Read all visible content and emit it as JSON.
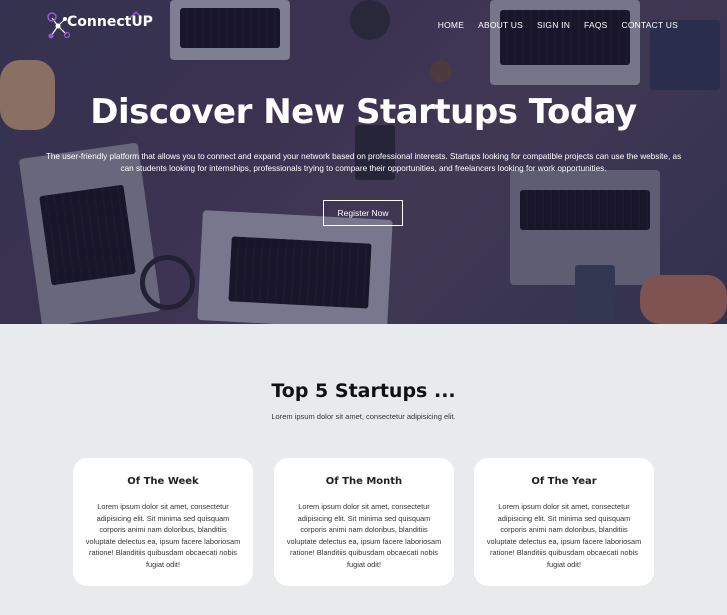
{
  "nav": {
    "brand": "ConnectUP",
    "links": [
      "HOME",
      "ABOUT US",
      "SIGN IN",
      "FAQS",
      "CONTACT US"
    ]
  },
  "hero": {
    "title": "Discover New Startups Today",
    "description": "The user-friendly platform that allows you to connect and expand your network based on professional interests. Startups looking for compatible projects can use the website, as can students looking for internships, professionals trying to compare their opportunities, and freelancers looking for work opportunities.",
    "cta": "Register Now"
  },
  "section": {
    "title": "Top 5 Startups ...",
    "subtitle": "Lorem ipsum dolor sit amet, consectetur adipisicing elit.",
    "cards": [
      {
        "title": "Of The Week",
        "body": "Lorem ipsum dolor sit amet, consectetur adipisicing elit. Sit minima sed quisquam corporis animi nam doloribus, blanditiis voluptate delectus ea, ipsum facere laboriosam ratione! Blanditiis quibusdam obcaecati nobis fugiat odit!"
      },
      {
        "title": "Of The Month",
        "body": "Lorem ipsum dolor sit amet, consectetur adipisicing elit. Sit minima sed quisquam corporis animi nam doloribus, blanditiis voluptate delectus ea, ipsum facere laboriosam ratione! Blanditiis quibusdam obcaecati nobis fugiat odit!"
      },
      {
        "title": "Of The Year",
        "body": "Lorem ipsum dolor sit amet, consectetur adipisicing elit. Sit minima sed quisquam corporis animi nam doloribus, blanditiis voluptate delectus ea, ipsum facere laboriosam ratione! Blanditiis quibusdam obcaecati nobis fugiat odit!"
      }
    ]
  },
  "colors": {
    "page_bg": "#e9eaec",
    "hero_overlay": "#282346",
    "logo_accent": "#9b59d6",
    "card_bg": "#ffffff"
  }
}
